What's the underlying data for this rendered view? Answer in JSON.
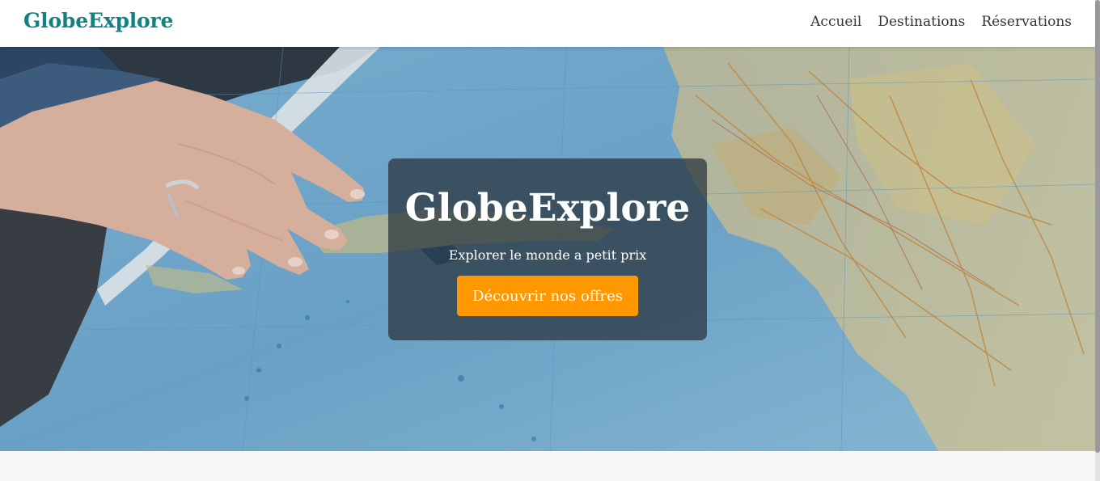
{
  "header": {
    "logo": "GlobeExplore",
    "nav": [
      {
        "label": "Accueil"
      },
      {
        "label": "Destinations"
      },
      {
        "label": "Réservations"
      }
    ]
  },
  "hero": {
    "title": "GlobeExplore",
    "subtitle": "Explorer le monde a petit prix",
    "cta_label": "Découvrir nos offres",
    "background": "hand-on-map-photo"
  },
  "colors": {
    "brand": "#167f7f",
    "accent": "#ff9800",
    "nav_text": "#333333",
    "page_bg": "#f7f7f7"
  }
}
